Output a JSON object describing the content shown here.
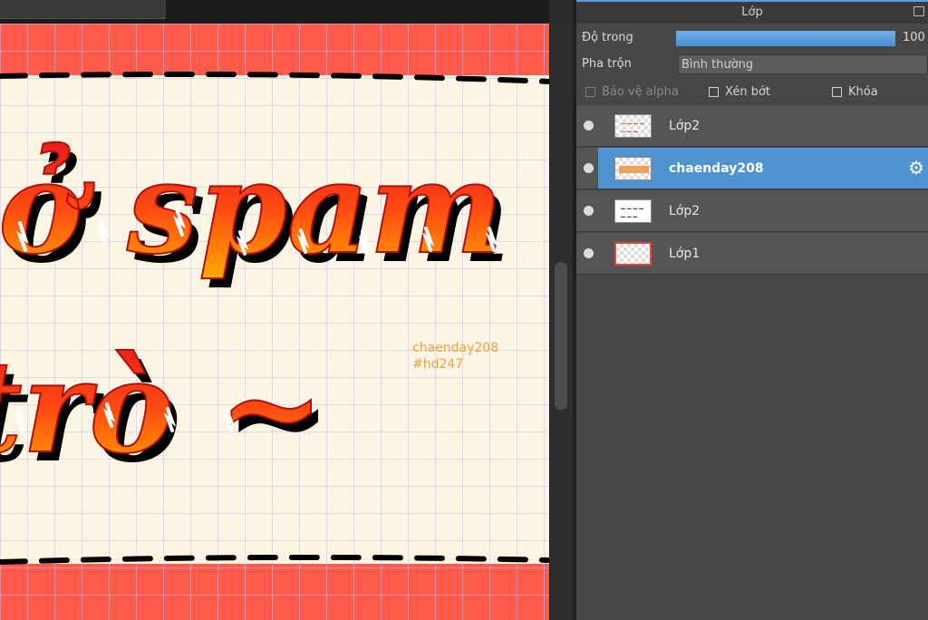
{
  "panel": {
    "title": "Lớp",
    "opacity_label": "Độ trong",
    "opacity_value": "100 %",
    "opacity_fraction": 1.0,
    "blend_label": "Pha trộn",
    "blend_value": "Bình thường",
    "checkboxes": {
      "protect_alpha": "Bảo vệ alpha",
      "clipping": "Xén bớt",
      "lock": "Khóa"
    },
    "layers": [
      {
        "name": "Lớp2"
      },
      {
        "name": "chaenday208"
      },
      {
        "name": "Lớp2"
      },
      {
        "name": "Lớp1"
      }
    ]
  },
  "canvas": {
    "line1": "ở spam",
    "line2": "trò ~",
    "tag_line1": "chaenday208",
    "tag_line2": "#hd247",
    "colors": {
      "border": "#ff5a4a",
      "paper": "#fdf5e4",
      "grid": "#b9b3e6",
      "text_top": "#e8201c",
      "text_bottom": "#ffb300",
      "tag": "#f3a03a"
    }
  },
  "icons": {
    "settings": "gear-icon",
    "visibility": "eye-icon"
  }
}
